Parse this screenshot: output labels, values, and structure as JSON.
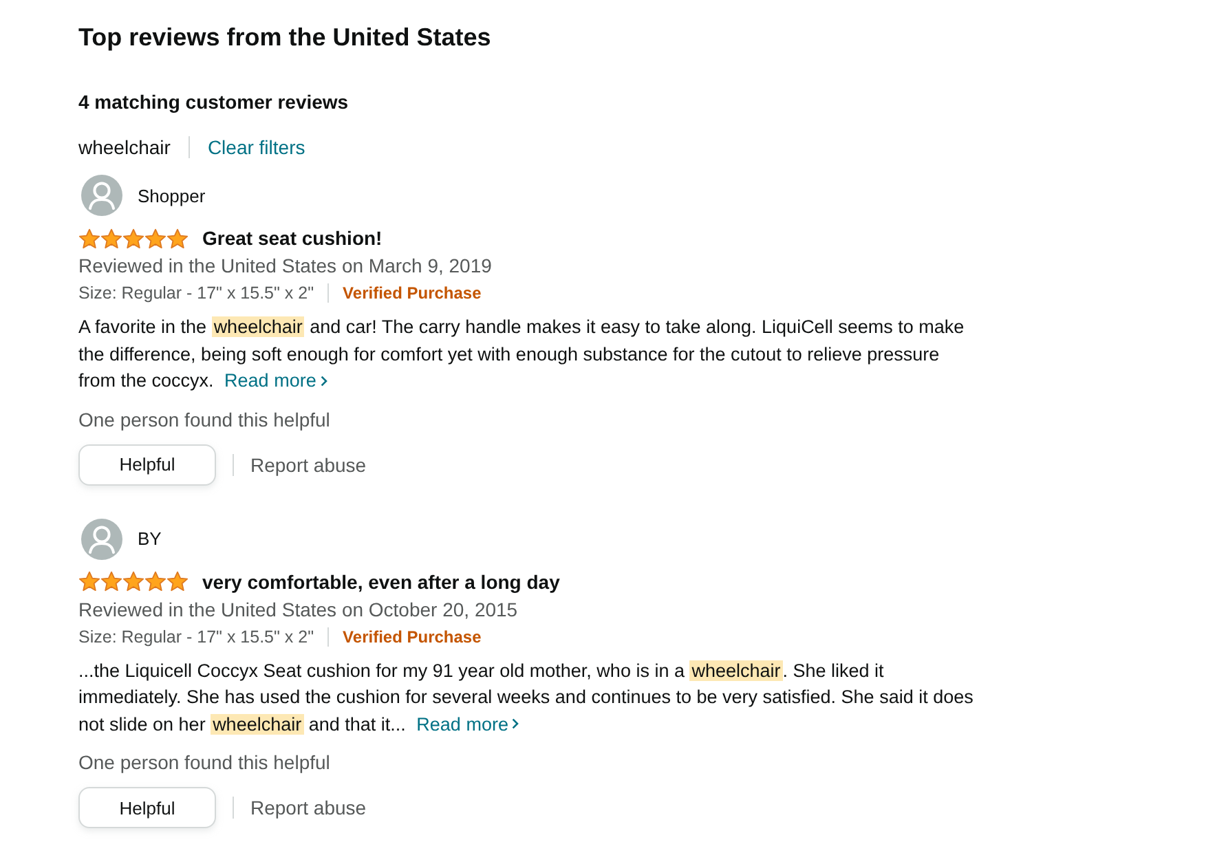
{
  "heading": "Top reviews from the United States",
  "match_count": "4 matching customer reviews",
  "filter": {
    "term": "wheelchair",
    "clear_link": "Clear filters"
  },
  "reviews": [
    {
      "author": "Shopper",
      "stars": 5,
      "title": "Great seat cushion!",
      "date": "Reviewed in the United States on March 9, 2019",
      "size": "Size: Regular - 17\" x 15.5\" x 2\"",
      "badge": "Verified Purchase",
      "body": [
        {
          "text": "A favorite in the ",
          "highlight": false
        },
        {
          "text": "wheelchair",
          "highlight": true
        },
        {
          "text": " and car! The carry handle makes it easy to take along. LiquiCell seems to make the difference, being soft enough for comfort yet with enough substance for the cutout to relieve pressure from the coccyx.",
          "highlight": false
        }
      ],
      "read_more": "Read more",
      "helpful_count": "One person found this helpful",
      "helpful_button": "Helpful",
      "report_link": "Report abuse"
    },
    {
      "author": "BY",
      "stars": 5,
      "title": "very comfortable, even after a long day",
      "date": "Reviewed in the United States on October 20, 2015",
      "size": "Size: Regular - 17\" x 15.5\" x 2\"",
      "badge": "Verified Purchase",
      "body": [
        {
          "text": "...the Liquicell Coccyx Seat cushion for my 91 year old mother, who is in a ",
          "highlight": false
        },
        {
          "text": "wheelchair",
          "highlight": true
        },
        {
          "text": ". She liked it immediately. She has used the cushion for several weeks and continues to be very satisfied. She said it does not slide on her ",
          "highlight": false
        },
        {
          "text": "wheelchair",
          "highlight": true
        },
        {
          "text": " and that it...",
          "highlight": false
        }
      ],
      "read_more": "Read more",
      "helpful_count": "One person found this helpful",
      "helpful_button": "Helpful",
      "report_link": "Report abuse"
    }
  ]
}
